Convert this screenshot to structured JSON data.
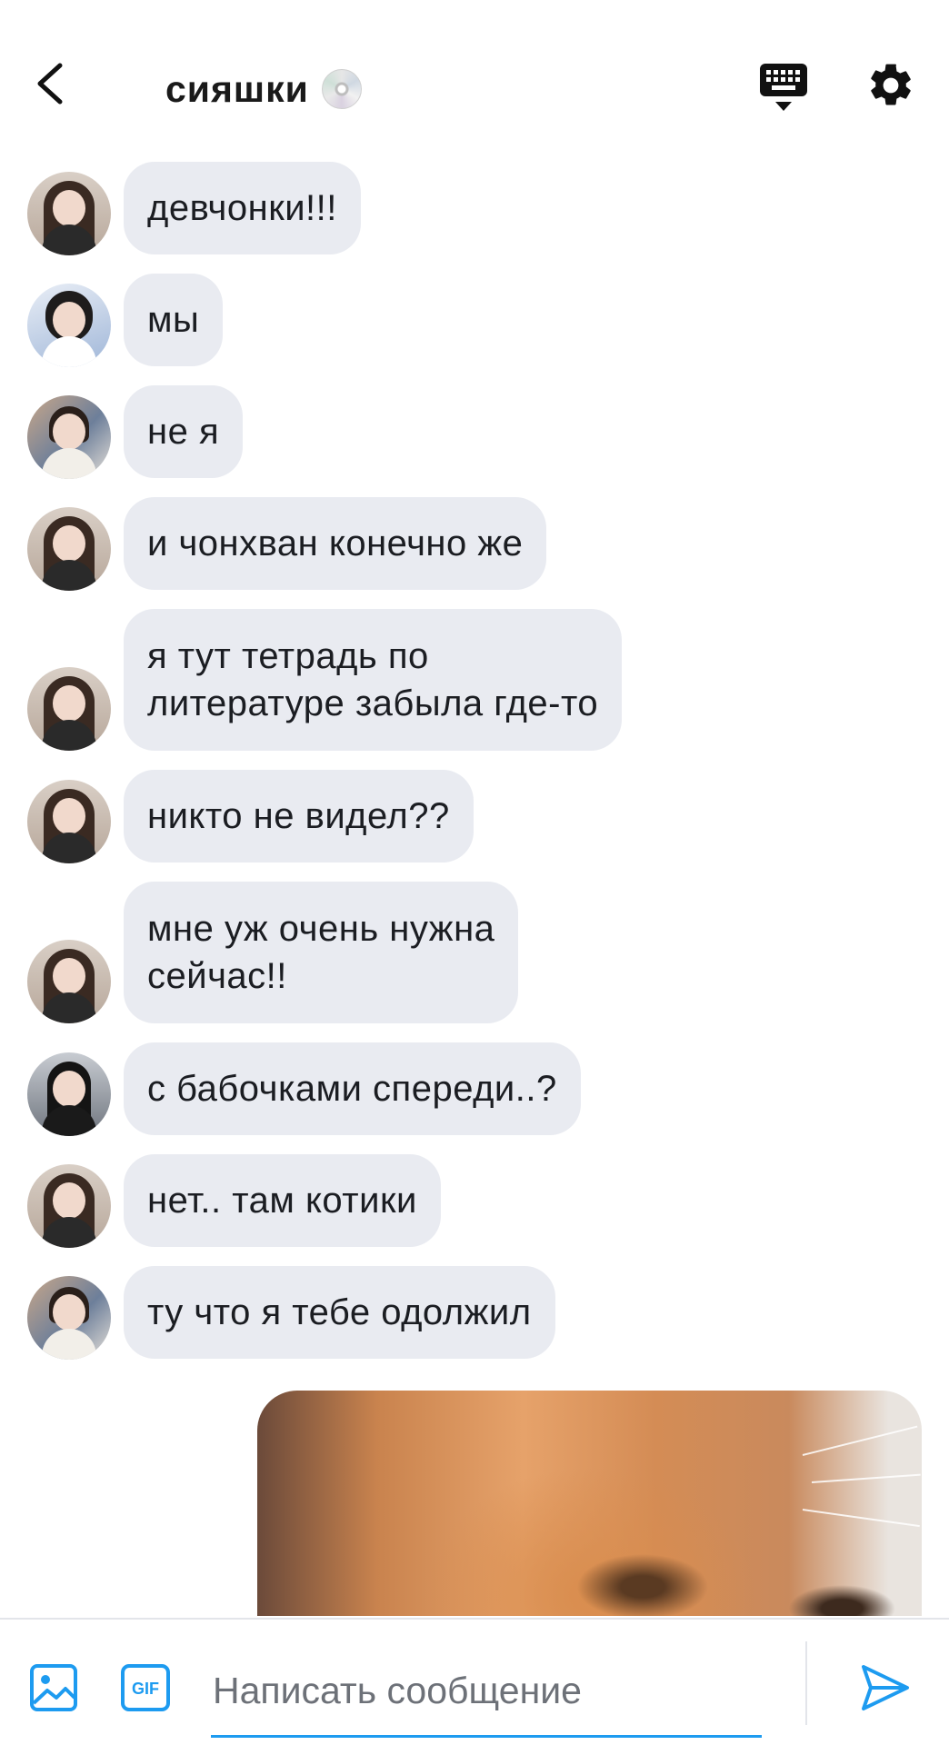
{
  "header": {
    "title": "сияшки",
    "title_icon": "cd-disc-icon",
    "back_icon": "chevron-left-icon",
    "keyboard_icon": "keyboard-dismiss-icon",
    "settings_icon": "gear-icon"
  },
  "messages": [
    {
      "avatar": "a",
      "text": "девчонки!!!"
    },
    {
      "avatar": "b",
      "text": "мы"
    },
    {
      "avatar": "c",
      "text": "не я"
    },
    {
      "avatar": "a",
      "text": "и чонхван конечно же"
    },
    {
      "avatar": "a",
      "text": "я тут тетрадь по\nлитературе забыла где-то"
    },
    {
      "avatar": "a",
      "text": "никто не видел??"
    },
    {
      "avatar": "a",
      "text": "мне уж очень нужна\nсейчас!!"
    },
    {
      "avatar": "d",
      "text": "с бабочками спереди..?"
    },
    {
      "avatar": "a",
      "text": "нет.. там котики"
    },
    {
      "avatar": "c",
      "text": "ту что я тебе одолжил"
    }
  ],
  "outgoing_image": {
    "kind": "photo of a ginger cat close-up"
  },
  "composer": {
    "placeholder": "Написать сообщение",
    "image_icon": "image-icon",
    "gif_icon": "gif-icon",
    "gif_label": "GIF",
    "send_icon": "send-icon"
  },
  "colors": {
    "accent": "#1d9bf0",
    "bubble": "#e9ebf1",
    "text": "#1b1d22"
  }
}
